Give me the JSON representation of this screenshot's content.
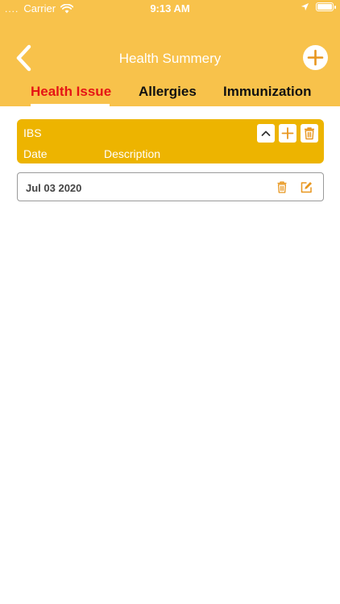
{
  "status_bar": {
    "signal": "....",
    "carrier": "Carrier",
    "time": "9:13 AM"
  },
  "nav": {
    "title": "Health Summery",
    "back_icon": "chevron-left-icon",
    "add_icon": "plus-circle-icon"
  },
  "tabs": [
    {
      "label": "Health Issue",
      "active": true
    },
    {
      "label": "Allergies",
      "active": false
    },
    {
      "label": "Immunization",
      "active": false
    }
  ],
  "issue": {
    "name": "IBS",
    "columns": [
      "Date",
      "Description"
    ],
    "actions": [
      "chevron-up-icon",
      "plus-icon",
      "trash-icon"
    ]
  },
  "entries": [
    {
      "date": "Jul 03 2020",
      "description": ""
    }
  ],
  "colors": {
    "header": "#F8C24B",
    "card": "#EDB400",
    "active_tab": "#E51515",
    "icon_orange": "#E8961E"
  }
}
